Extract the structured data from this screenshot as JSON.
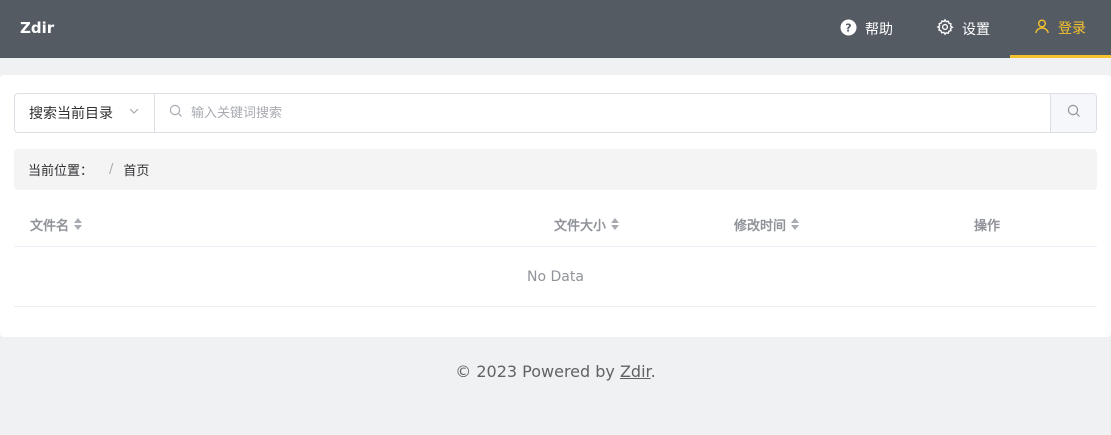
{
  "header": {
    "brand": "Zdir",
    "nav": {
      "help": "帮助",
      "settings": "设置",
      "login": "登录"
    },
    "accent_color": "#f5c22c",
    "background_color": "#555b63"
  },
  "search": {
    "scope_selected": "搜索当前目录",
    "placeholder": "输入关键词搜索",
    "value": ""
  },
  "breadcrumb": {
    "label": "当前位置：",
    "separator": "/",
    "items": [
      "首页"
    ]
  },
  "table": {
    "columns": [
      "文件名",
      "文件大小",
      "修改时间",
      "操作"
    ],
    "rows": [],
    "empty_text": "No Data"
  },
  "footer": {
    "prefix": "© 2023 Powered by ",
    "link_text": "Zdir",
    "suffix": "."
  }
}
